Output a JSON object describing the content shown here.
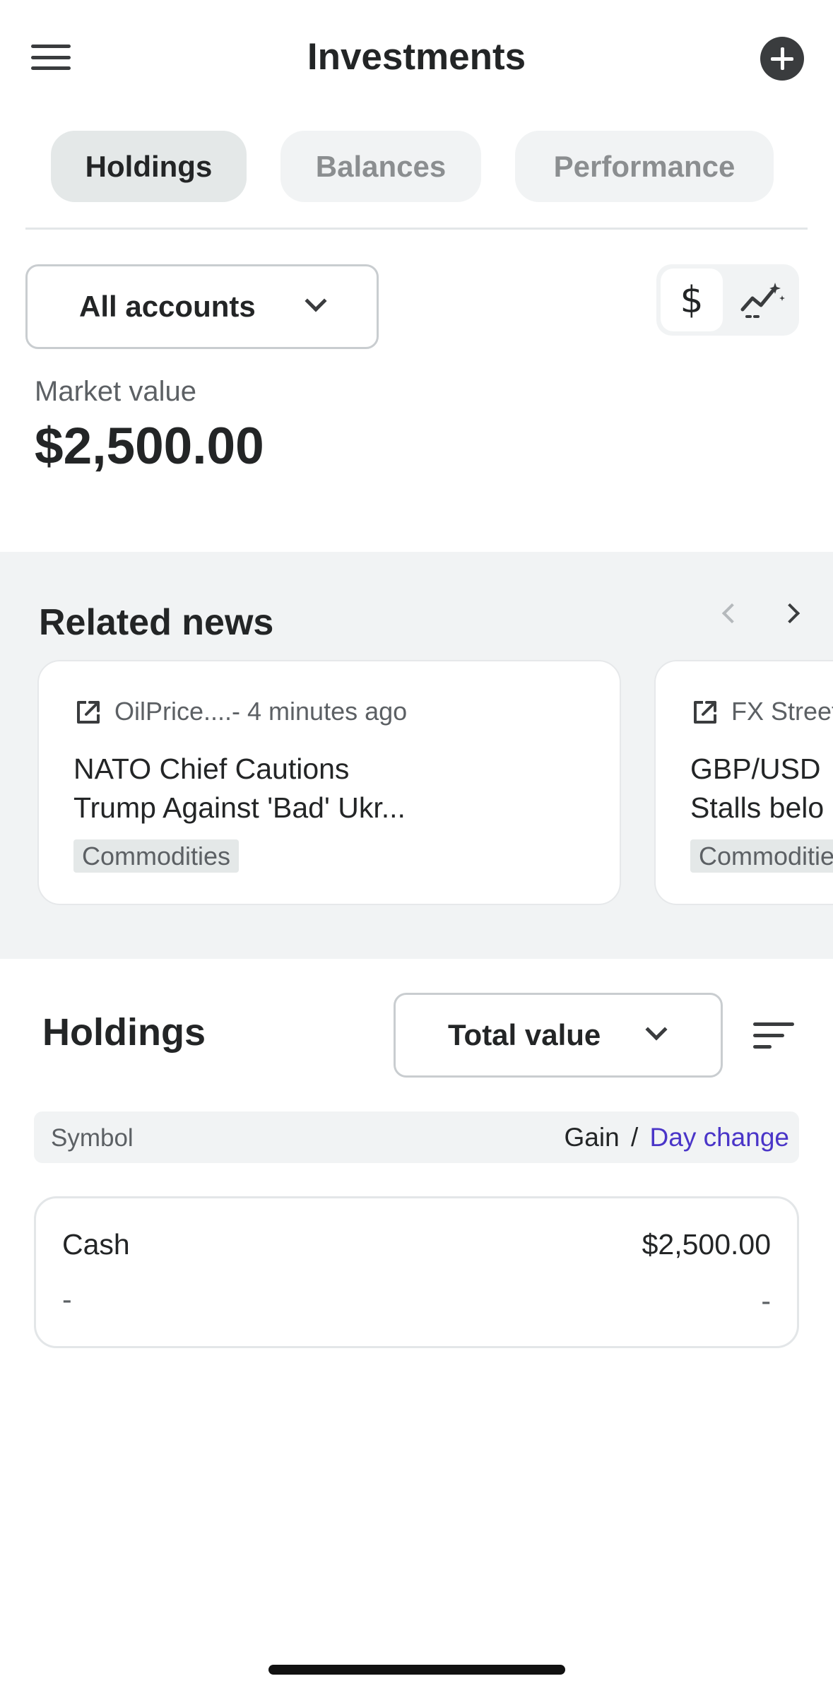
{
  "header": {
    "title": "Investments",
    "menu_icon": "hamburger-menu-icon",
    "add_icon": "plus-circle-icon"
  },
  "tabs": [
    {
      "label": "Holdings",
      "active": true
    },
    {
      "label": "Balances",
      "active": false
    },
    {
      "label": "Performance",
      "active": false
    }
  ],
  "account_filter": {
    "selected": "All accounts"
  },
  "view_toggle": {
    "dollar_label": "$",
    "dollar_selected": true,
    "chart_icon": "sparkle-chart-icon"
  },
  "market_value": {
    "label": "Market value",
    "value": "$2,500.00"
  },
  "news": {
    "title": "Related news",
    "cards": [
      {
        "meta": "OilPrice....- 4 minutes ago",
        "headline": "NATO Chief Cautions\nTrump Against 'Bad' Ukr...",
        "tag": "Commodities"
      },
      {
        "meta": "FX Street",
        "headline": "GBP/USD \nStalls belo",
        "tag": "Commodities"
      }
    ]
  },
  "holdings": {
    "title": "Holdings",
    "sort_selected": "Total value",
    "header": {
      "symbol": "Symbol",
      "gain": "Gain",
      "separator": "/",
      "day_change": "Day change"
    },
    "rows": [
      {
        "name": "Cash",
        "value": "$2,500.00",
        "gain": "-",
        "day_change": "-"
      }
    ]
  },
  "colors": {
    "text_primary": "#232526",
    "text_secondary": "#5c6064",
    "accent_link": "#4a35c8",
    "section_bg": "#f1f3f4"
  }
}
